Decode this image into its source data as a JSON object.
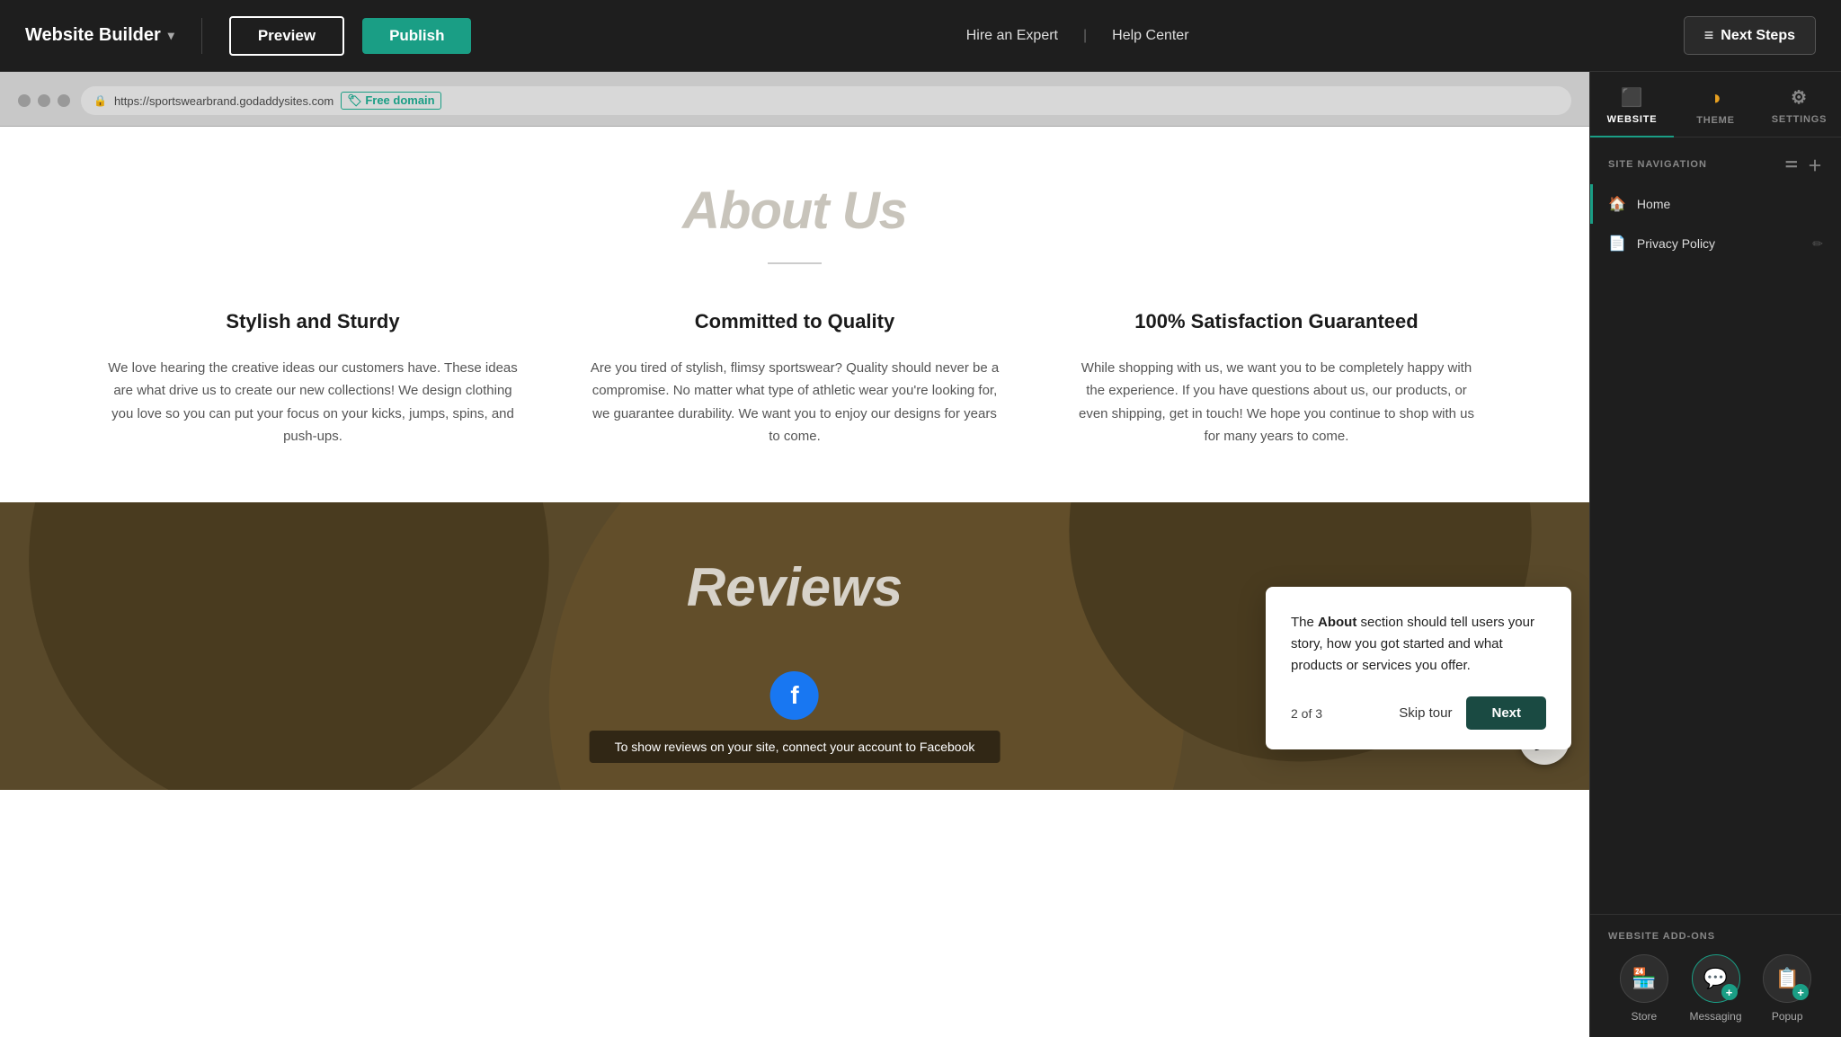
{
  "topbar": {
    "brand_label": "Website Builder",
    "chevron": "▾",
    "preview_label": "Preview",
    "publish_label": "Publish",
    "hire_expert_label": "Hire an Expert",
    "separator": "|",
    "help_center_label": "Help Center",
    "next_steps_label": "Next Steps",
    "next_steps_icon": "≡"
  },
  "browser": {
    "url": "https://sportswearbrand.godaddysites.com",
    "free_domain_label": "🏷 Free domain"
  },
  "about_section": {
    "title": "About Us",
    "divider": "",
    "columns": [
      {
        "heading": "Stylish and Sturdy",
        "body": "We love hearing the creative ideas our customers have. These ideas are what drive us to create our new collections! We design clothing you love so you can put your focus on your kicks, jumps, spins, and push-ups."
      },
      {
        "heading": "Committed to Quality",
        "body": "Are you tired of stylish, flimsy sportswear? Quality should never be a compromise. No matter what type of athletic wear you're looking for, we guarantee durability. We want you to enjoy our designs for years to come."
      },
      {
        "heading": "100% Satisfaction Guaranteed",
        "body": "While shopping with us, we want you to be completely happy with the experience. If you have questions about us, our products, or even shipping, get in touch! We hope you continue to shop with us for many years to come."
      }
    ]
  },
  "reviews_section": {
    "title": "Reviews",
    "fb_connect_text": "To show reviews on your site, connect your account to Facebook"
  },
  "tooltip": {
    "text_prefix": "The ",
    "text_bold": "About",
    "text_suffix": " section should tell users your story, how you got started and what products or services you offer.",
    "counter": "2 of 3",
    "skip_label": "Skip tour",
    "next_label": "Next"
  },
  "sidebar": {
    "tabs": [
      {
        "label": "WEBSITE",
        "icon": "⬛",
        "active": true
      },
      {
        "label": "THEME",
        "icon": "⬤"
      },
      {
        "label": "SETTINGS",
        "icon": "⚙"
      }
    ],
    "site_navigation_label": "SITE NAVIGATION",
    "nav_items": [
      {
        "label": "Home",
        "icon": "🏠",
        "active": true
      },
      {
        "label": "Privacy Policy",
        "icon": "📄",
        "active": false,
        "has_edit": true
      }
    ],
    "addons_label": "WEBSITE ADD-ONS",
    "addons": [
      {
        "label": "Store",
        "icon": "🏪",
        "has_badge": false
      },
      {
        "label": "Messaging",
        "icon": "💬",
        "has_badge": true
      },
      {
        "label": "Popup",
        "icon": "📋",
        "has_badge": true
      }
    ]
  },
  "colors": {
    "accent_teal": "#1a9e85",
    "dark_teal": "#1a4a42",
    "sidebar_bg": "#1e1e1e",
    "topbar_bg": "#1e1e1e",
    "canvas_bg": "#b0b0b0"
  }
}
